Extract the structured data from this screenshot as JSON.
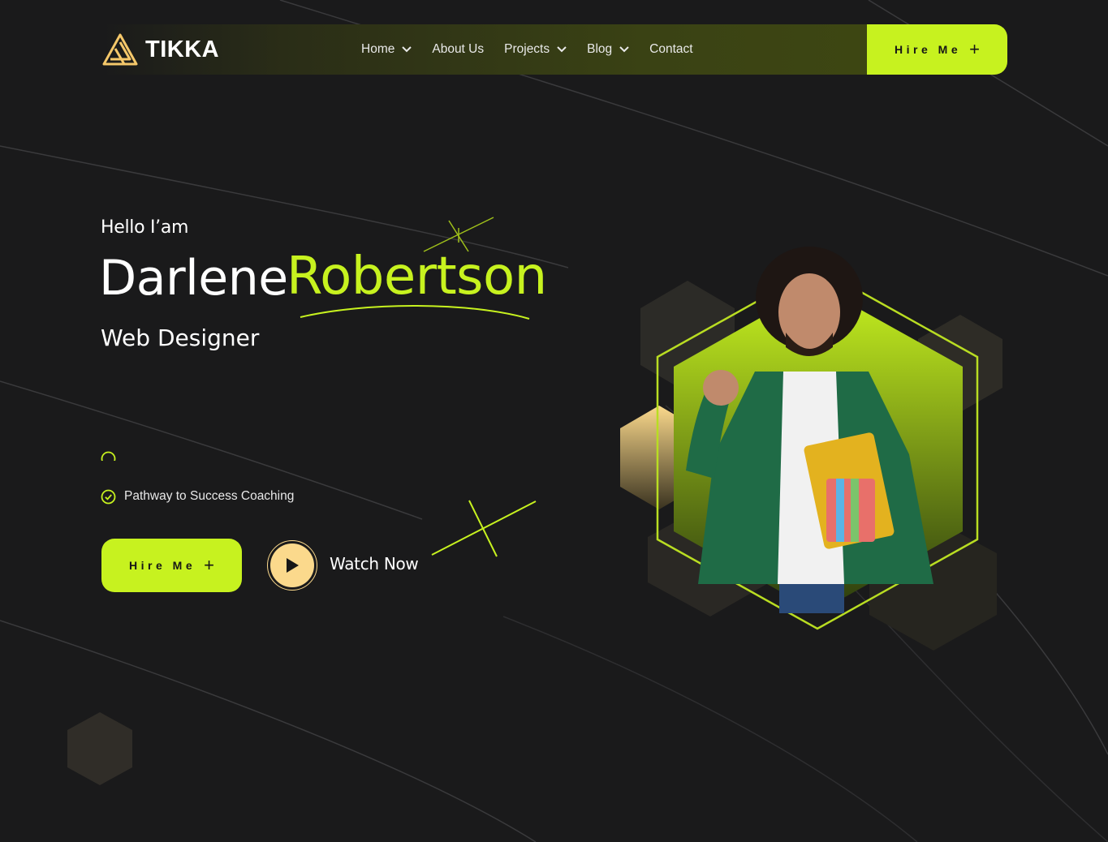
{
  "brand": {
    "name": "TIKKA"
  },
  "nav": {
    "items": [
      {
        "label": "Home",
        "has_dropdown": true
      },
      {
        "label": "About Us",
        "has_dropdown": false
      },
      {
        "label": "Projects",
        "has_dropdown": true
      },
      {
        "label": "Blog",
        "has_dropdown": true
      },
      {
        "label": "Contact",
        "has_dropdown": false
      }
    ],
    "cta_label": "Hire Me"
  },
  "hero": {
    "greeting": "Hello I’am",
    "first_name": "Darlene",
    "last_name": "Robertson",
    "role": "Web Designer",
    "list": [
      {
        "label": "Pathway to Success Coaching"
      }
    ],
    "cta_label": "Hire Me",
    "watch_label": "Watch Now"
  },
  "icons": {
    "logo": "tikka-logo-icon",
    "chevron": "chevron-down-icon",
    "plus": "plus-icon",
    "check": "check-circle-icon",
    "play": "play-icon"
  },
  "colors": {
    "background": "#1a1a1b",
    "accent": "#c7f21f",
    "gold": "#fbd98c",
    "text": "#ffffff"
  }
}
